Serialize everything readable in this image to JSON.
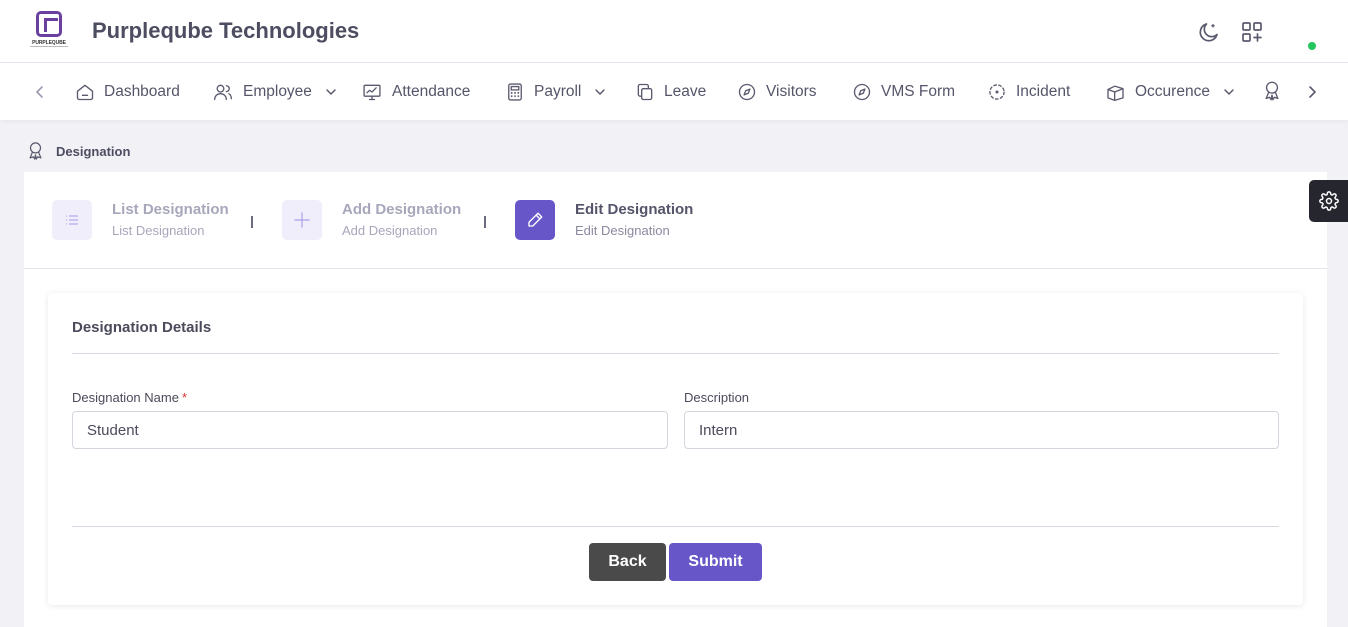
{
  "header": {
    "logo_text": "PURPLEQUBE",
    "brand": "Purpleqube Technologies",
    "icons": [
      "moon-icon",
      "apps-add-icon"
    ],
    "status_color": "#22c55e"
  },
  "nav": {
    "items": [
      {
        "label": "Dashboard",
        "icon": "home-icon"
      },
      {
        "label": "Employee",
        "icon": "users-icon",
        "has_dropdown": true
      },
      {
        "label": "Attendance",
        "icon": "monitor-chart-icon"
      },
      {
        "label": "Payroll",
        "icon": "calculator-icon",
        "has_dropdown": true
      },
      {
        "label": "Leave",
        "icon": "copy-icon"
      },
      {
        "label": "Visitors",
        "icon": "compass-icon"
      },
      {
        "label": "VMS Form",
        "icon": "compass-icon"
      },
      {
        "label": "Incident",
        "icon": "focus-icon"
      },
      {
        "label": "Occurence",
        "icon": "boxes-icon",
        "has_dropdown": true
      }
    ],
    "trailing_icon": "award-icon"
  },
  "breadcrumb": {
    "label": "Designation",
    "icon": "award-icon"
  },
  "steps": [
    {
      "title": "List Designation",
      "subtitle": "List Designation",
      "icon": "list-icon",
      "active": false
    },
    {
      "title": "Add Designation",
      "subtitle": "Add Designation",
      "icon": "plus-icon",
      "active": false
    },
    {
      "title": "Edit Designation",
      "subtitle": "Edit Designation",
      "icon": "pencil-icon",
      "active": true
    }
  ],
  "form": {
    "title": "Designation Details",
    "designation_name": {
      "label": "Designation Name",
      "required_mark": "*",
      "value": "Student"
    },
    "description": {
      "label": "Description",
      "value": "Intern"
    },
    "back_label": "Back",
    "submit_label": "Submit"
  },
  "colors": {
    "accent": "#6656c8",
    "back_button": "#4a4a4a",
    "settings_tab": "#26262e"
  }
}
